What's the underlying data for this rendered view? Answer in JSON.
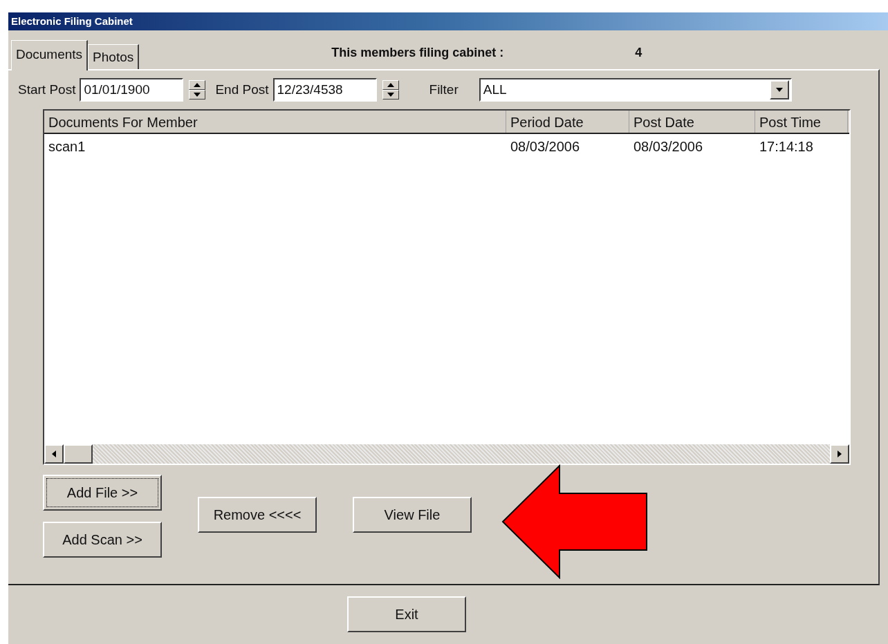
{
  "window": {
    "title": "Electronic Filing Cabinet"
  },
  "tabs": [
    {
      "label": "Documents",
      "selected": true
    },
    {
      "label": "Photos",
      "selected": false
    }
  ],
  "cabinet": {
    "label": "This members filing cabinet :",
    "count": "4"
  },
  "filters": {
    "start_label": "Start Post",
    "start_value": "01/01/1900",
    "end_label": "End Post",
    "end_value": "12/23/4538",
    "filter_label": "Filter",
    "filter_value": "ALL"
  },
  "table": {
    "columns": [
      "Documents For Member",
      "Period  Date",
      "Post Date",
      "Post Time"
    ],
    "rows": [
      [
        "scan1",
        "08/03/2006",
        "08/03/2006",
        "17:14:18"
      ]
    ]
  },
  "buttons": [
    {
      "label": "Add File >>",
      "focused": true
    },
    {
      "label": "Add Scan >>",
      "focused": false
    },
    {
      "label": "Remove <<<<",
      "focused": false
    },
    {
      "label": "View File",
      "focused": false
    }
  ],
  "exit_button": {
    "label": "Exit"
  }
}
